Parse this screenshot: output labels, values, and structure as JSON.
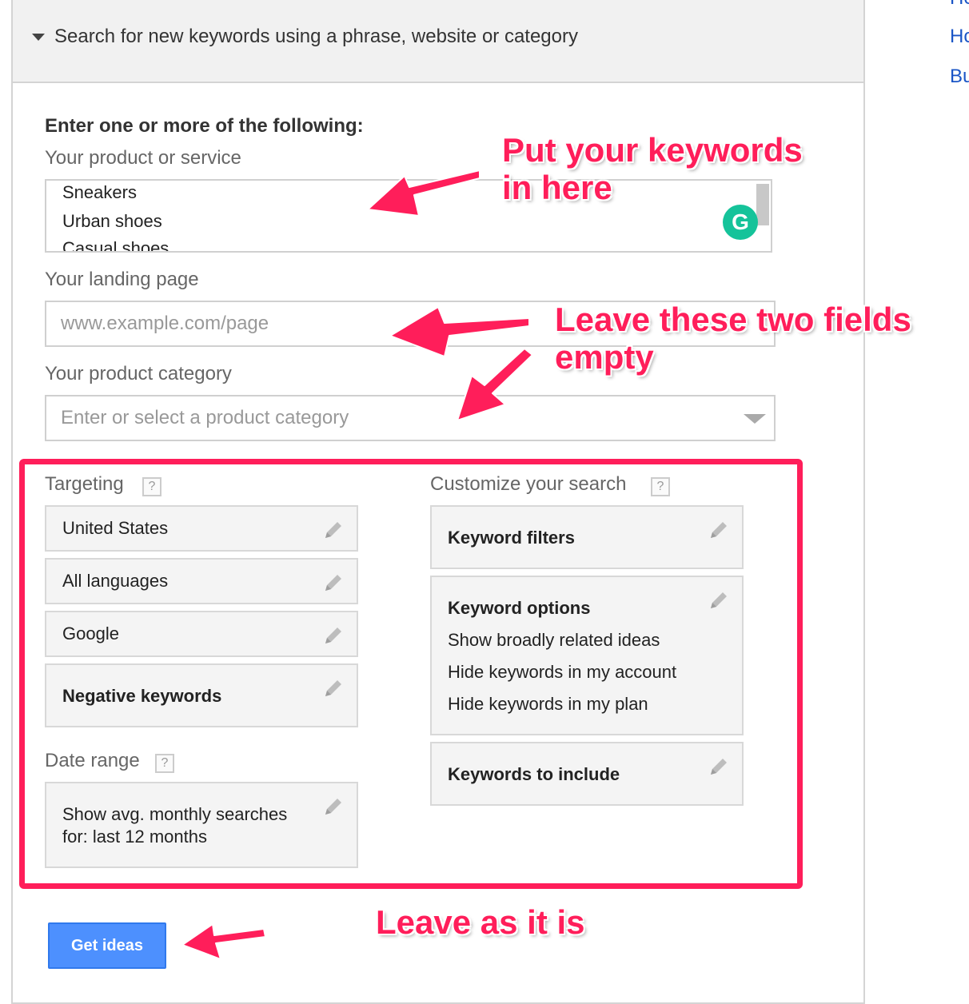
{
  "header": {
    "title": "Search for new keywords using a phrase, website or category"
  },
  "right_links": [
    "He",
    "Ho",
    "Bu"
  ],
  "form": {
    "instructions": "Enter one or more of the following:",
    "product_label": "Your product or service",
    "product_lines": [
      "Sneakers",
      "Urban shoes",
      "Casual shoes"
    ],
    "landing_label": "Your landing page",
    "landing_placeholder": "www.example.com/page",
    "category_label": "Your product category",
    "category_placeholder": "Enter or select a product category"
  },
  "targeting": {
    "label": "Targeting",
    "help": "?",
    "items": [
      "United States",
      "All languages",
      "Google",
      "Negative keywords"
    ]
  },
  "date_range": {
    "label": "Date range",
    "help": "?",
    "line1": "Show avg. monthly searches",
    "line2": "for: last 12 months"
  },
  "customize": {
    "label": "Customize your search",
    "help": "?",
    "filters": "Keyword filters",
    "options_title": "Keyword options",
    "options": [
      "Show broadly related ideas",
      "Hide keywords in my account",
      "Hide keywords in my plan"
    ],
    "include": "Keywords to include"
  },
  "button": {
    "label": "Get ideas"
  },
  "annotations": {
    "keywords": [
      "Put your keywords",
      "in here"
    ],
    "empty": [
      "Leave these two fields",
      "empty"
    ],
    "leave": "Leave as it is"
  },
  "colors": {
    "accent": "#ff1e5a",
    "button": "#4d90fe",
    "link": "#1a55c6"
  },
  "icons": [
    "caret-down-icon",
    "grammarly-icon",
    "dropdown-arrow-icon",
    "pencil-icon",
    "help-icon"
  ]
}
